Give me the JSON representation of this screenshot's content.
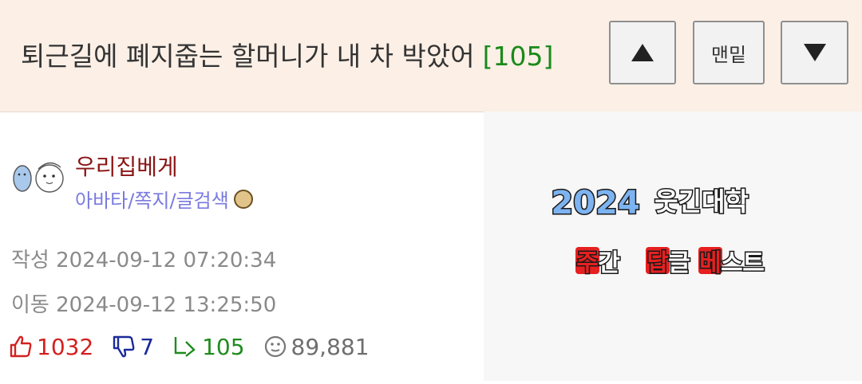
{
  "header": {
    "title": "퇴근길에 폐지줍는 할머니가 내 차 박았어",
    "comment_count": "[105]",
    "bottom_button_label": "맨밑"
  },
  "author": {
    "nickname": "우리집베게",
    "links": "아바타/쪽지/글검색"
  },
  "meta": {
    "created": "작성 2024-09-12 07:20:34",
    "moved": "이동 2024-09-12 13:25:50"
  },
  "stats": {
    "likes": "1032",
    "dislikes": "7",
    "replies": "105",
    "views": "89,881"
  },
  "banner": {
    "year": "2024",
    "site": "웃긴대학",
    "words": [
      "주",
      "간",
      "답",
      "글",
      "베",
      "스",
      "트"
    ],
    "accent_color": "#e62020",
    "year_color": "#7db3f0"
  },
  "colors": {
    "header_bg": "#fbefe6",
    "nickname": "#8a1414",
    "link": "#7a7ae0",
    "count": "#1a8a1a"
  }
}
